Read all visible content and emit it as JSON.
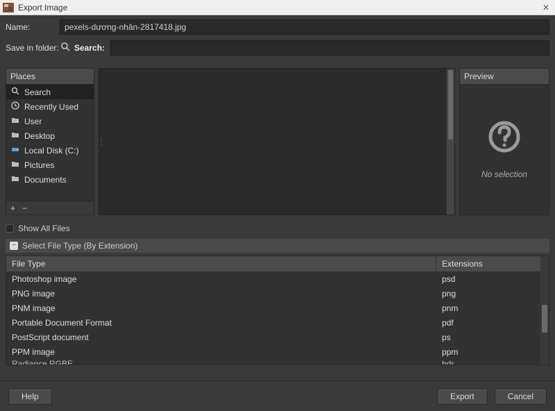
{
  "titlebar": {
    "title": "Export Image"
  },
  "name": {
    "label": "Name:",
    "value": "pexels-dương-nhân-2817418.jpg"
  },
  "folder": {
    "label": "Save in folder:",
    "search_label": "Search:"
  },
  "places": {
    "header": "Places",
    "items": [
      {
        "icon": "search-icon",
        "label": "Search",
        "selected": true
      },
      {
        "icon": "clock-icon",
        "label": "Recently Used"
      },
      {
        "icon": "folder-icon",
        "label": "User"
      },
      {
        "icon": "folder-icon",
        "label": "Desktop"
      },
      {
        "icon": "drive-icon",
        "label": "Local Disk (C:)",
        "blue": true
      },
      {
        "icon": "folder-icon",
        "label": "Pictures"
      },
      {
        "icon": "folder-icon",
        "label": "Documents"
      }
    ]
  },
  "preview": {
    "header": "Preview",
    "empty_text": "No selection"
  },
  "show_all": {
    "label": "Show All Files"
  },
  "filetype_expander": {
    "label": "Select File Type (By Extension)"
  },
  "filetype_table": {
    "col_type": "File Type",
    "col_ext": "Extensions",
    "rows": [
      {
        "type": "Photoshop image",
        "ext": "psd"
      },
      {
        "type": "PNG image",
        "ext": "png"
      },
      {
        "type": "PNM image",
        "ext": "pnm"
      },
      {
        "type": "Portable Document Format",
        "ext": "pdf"
      },
      {
        "type": "PostScript document",
        "ext": "ps"
      },
      {
        "type": "PPM image",
        "ext": "ppm"
      },
      {
        "type": "Radiance RGBE",
        "ext": "hdr"
      }
    ]
  },
  "buttons": {
    "help": "Help",
    "export": "Export",
    "cancel": "Cancel"
  }
}
